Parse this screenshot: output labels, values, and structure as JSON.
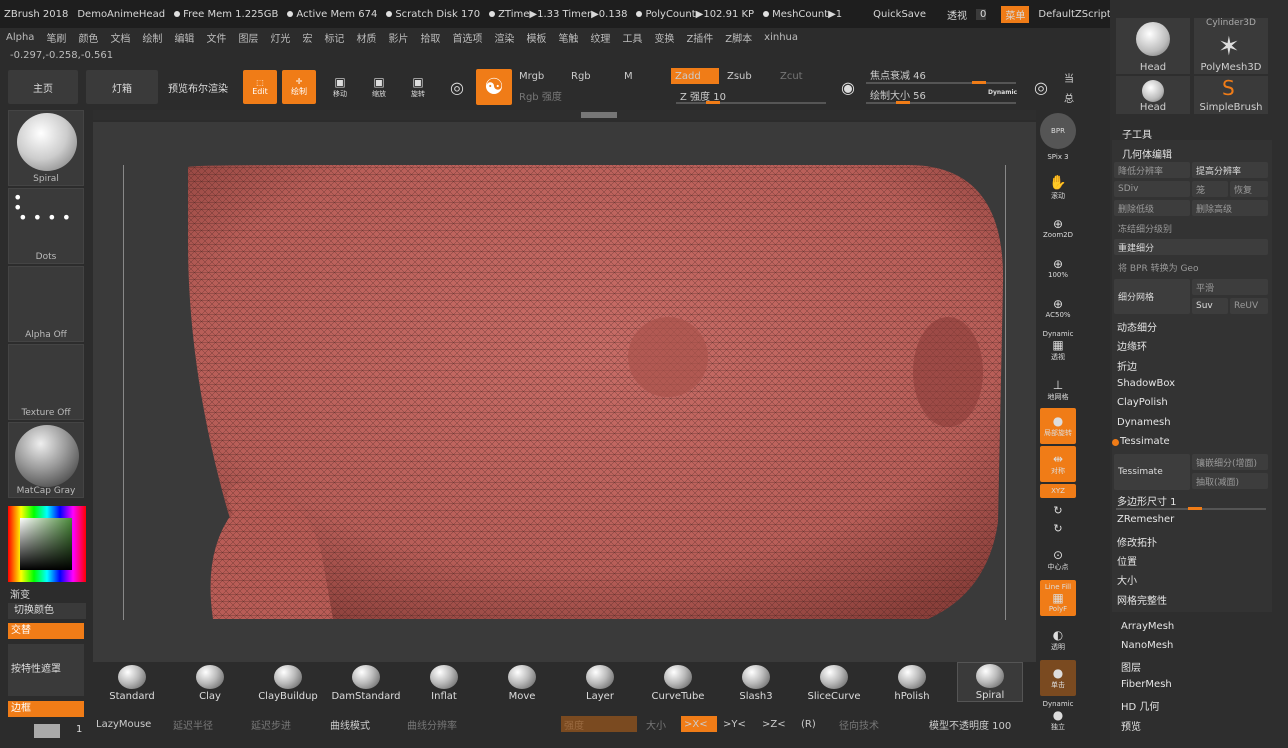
{
  "titlebar": {
    "app": "ZBrush 2018",
    "project": "DemoAnimeHead",
    "free_mem": "Free Mem 1.225GB",
    "active_mem": "Active Mem 674",
    "scratch": "Scratch Disk 170",
    "ztime": "ZTime▶1.33 Timer▶0.138",
    "polycount": "PolyCount▶102.91 KP",
    "meshcount": "MeshCount▶1",
    "quicksave": "QuickSave",
    "transparency_label": "透视",
    "transparency_value": "0",
    "menu_label": "菜单",
    "script_label": "DefaultZScript"
  },
  "menus": [
    "Alpha",
    "笔刷",
    "颜色",
    "文档",
    "绘制",
    "编辑",
    "文件",
    "图层",
    "灯光",
    "宏",
    "标记",
    "材质",
    "影片",
    "拾取",
    "首选项",
    "渲染",
    "模板",
    "笔触",
    "纹理",
    "工具",
    "变换",
    "Z插件",
    "Z脚本",
    "xinhua"
  ],
  "coords": "-0.297,-0.258,-0.561",
  "toolbar": {
    "home": "主页",
    "lightbox": "灯箱",
    "bpr": "预览布尔渲染",
    "edit": "Edit",
    "draw": "绘制",
    "move": "移动",
    "scale": "缩放",
    "rotate": "旋转",
    "mrgb": "Mrgb",
    "rgb": "Rgb",
    "m": "M",
    "rgb_intensity": "Rgb 强度",
    "zadd": "Zadd",
    "zsub": "Zsub",
    "zcut": "Zcut",
    "z_intensity": "Z 强度 10",
    "focal_shift": "焦点衰减 46",
    "draw_size": "绘制大小 56",
    "dynamic": "Dynamic",
    "rt1": "当",
    "rt2": "总"
  },
  "left": {
    "spiral": "Spiral",
    "dots": "Dots",
    "alpha_off": "Alpha Off",
    "texture_off": "Texture Off",
    "matcap": "MatCap Gray",
    "gradient": "渐变",
    "switch_color": "切换颜色",
    "alternate": "交替",
    "mask_by_feature": "按特性遮罩",
    "border": "边框",
    "count": "1"
  },
  "righticons": {
    "bpr": "BPR",
    "spix": "SPix 3",
    "scroll": "滚动",
    "zoom2d": "Zoom2D",
    "zoom100": "100%",
    "ac50": "AC50%",
    "dynamic": "Dynamic",
    "persp": "透视",
    "floor": "地网格",
    "local": "局部旋转",
    "sym": "对称",
    "xyz": "XYZ",
    "center": "中心点",
    "linefill": "Line Fill",
    "polyf": "PolyF",
    "transp": "透明",
    "solo": "单击",
    "dyn2": "Dynamic",
    "solo2": "独立"
  },
  "rightpanel": {
    "head1": "Head",
    "polymesh": "PolyMesh3D",
    "head2": "Head",
    "simplebrush": "SimpleBrush",
    "cylinder": "Cylinder3D",
    "subtool": "子工具",
    "geometry": "几何体编辑",
    "lower_res": "降低分辨率",
    "higher_res": "提高分辨率",
    "sdiv": "SDiv",
    "cage": "笼",
    "restore": "恢复",
    "del_lower": "删除低级",
    "del_higher": "删除高级",
    "freeze": "冻结细分级别",
    "reconstruct": "重建细分",
    "bpr_geo": "将 BPR 转换为 Geo",
    "divide": "细分网格",
    "smooth": "平滑",
    "suv": "Suv",
    "reuv": "ReUV",
    "dynamic_sub": "动态细分",
    "edgeloop": "边缘环",
    "crease": "折边",
    "shadowbox": "ShadowBox",
    "claypolish": "ClayPolish",
    "dynamesh": "Dynamesh",
    "tessimate": "Tessimate",
    "tess_btn": "Tessimate",
    "tess_add": "镶嵌细分(增面)",
    "tess_remove": "抽取(减面)",
    "poly_size": "多边形尺寸 1",
    "zremesher": "ZRemesher",
    "modify_topo": "修改拓扑",
    "position": "位置",
    "size": "大小",
    "mesh_integrity": "网格完整性",
    "arraymesh": "ArrayMesh",
    "nanomesh": "NanoMesh",
    "layers": "图层",
    "fibermesh": "FiberMesh",
    "hd": "HD 几何",
    "preview": "预览"
  },
  "brushes": [
    "Standard",
    "Clay",
    "ClayBuildup",
    "DamStandard",
    "Inflat",
    "Move",
    "Layer",
    "CurveTube",
    "Slash3",
    "SliceCurve",
    "hPolish",
    "Spiral"
  ],
  "bottom": {
    "lazymouse": "LazyMouse",
    "lazy_radius": "延迟半径",
    "lazy_step": "延迟步进",
    "curve_mode": "曲线模式",
    "curve_res": "曲线分辨率",
    "intensity": "强度",
    "size": "大小",
    "x": ">X<",
    "y": ">Y<",
    "z": ">Z<",
    "r": "(R)",
    "radial": "径向技术",
    "opacity": "模型不透明度 100"
  }
}
